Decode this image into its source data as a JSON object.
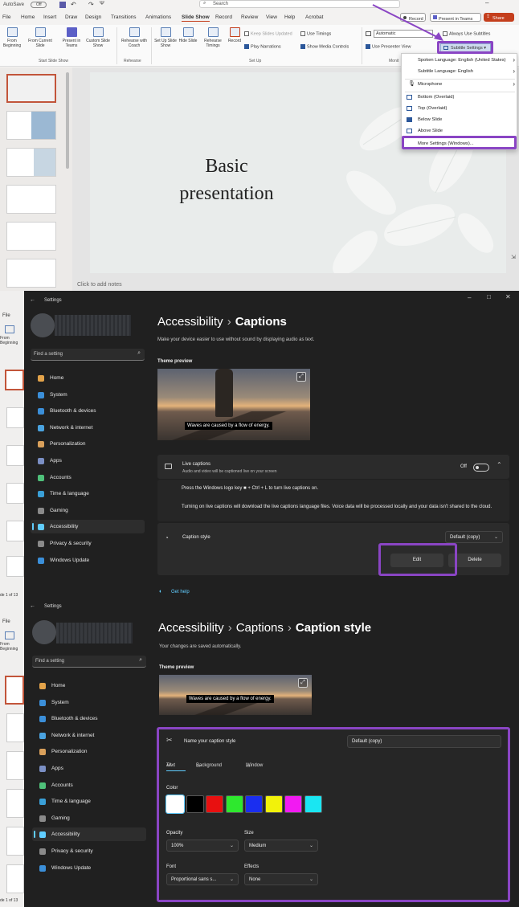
{
  "ppt": {
    "autosave": "AutoSave",
    "autosave_state": "Off",
    "search_placeholder": "Search",
    "menu": [
      "File",
      "Home",
      "Insert",
      "Draw",
      "Design",
      "Transitions",
      "Animations",
      "Slide Show",
      "Record",
      "Review",
      "View",
      "Help",
      "Acrobat"
    ],
    "active_menu": "Slide Show",
    "record_btn": "Record",
    "present_teams_btn": "Present in Teams",
    "share_btn": "Share",
    "ribbon": {
      "from_beginning": "From Beginning",
      "from_current": "From Current Slide",
      "present_teams": "Present in Teams",
      "custom_show": "Custom Slide Show",
      "group_start": "Start Slide Show",
      "rehearse_coach": "Rehearse with Coach",
      "group_rehearse": "Rehearse",
      "setup_show": "Set Up Slide Show",
      "hide_slide": "Hide Slide",
      "rehearse_timings": "Rehearse Timings",
      "record": "Record",
      "keep_updated": "Keep Slides Updated",
      "use_timings": "Use Timings",
      "play_narrations": "Play Narrations",
      "show_media": "Show Media Controls",
      "group_setup": "Set Up",
      "monitor_value": "Automatic",
      "presenter_view": "Use Presenter View",
      "always_subtitles": "Always Use Subtitles",
      "subtitle_settings": "Subtitle Settings",
      "group_monitors": "Monit"
    },
    "slide_title_line1": "Basic",
    "slide_title_line2": "presentation",
    "notes": "Click to add notes",
    "subtitle_menu": [
      {
        "label": "Spoken Language: English (United States)",
        "arrow": true
      },
      {
        "label": "Subtitle Language: English",
        "arrow": true
      },
      {
        "label": "Microphone",
        "arrow": true
      },
      {
        "label": "Bottom (Overlaid)",
        "arrow": false
      },
      {
        "label": "Top (Overlaid)",
        "arrow": false
      },
      {
        "label": "Below Slide",
        "arrow": false
      },
      {
        "label": "Above Slide",
        "arrow": false
      },
      {
        "label": "More Settings (Windows)...",
        "arrow": false
      }
    ],
    "bg_file": "File",
    "bg_from_beginning": "From Beginning",
    "bg_slide_count": "de 1 of 13"
  },
  "settings1": {
    "title": "Settings",
    "search_placeholder": "Find a setting",
    "nav": [
      "Home",
      "System",
      "Bluetooth & devices",
      "Network & internet",
      "Personalization",
      "Apps",
      "Accounts",
      "Time & language",
      "Gaming",
      "Accessibility",
      "Privacy & security",
      "Windows Update"
    ],
    "nav_colors": [
      "#e3a34a",
      "#3b8fd9",
      "#3b8fd9",
      "#4aa3e0",
      "#d9a05b",
      "#7b8fc4",
      "#4fc17a",
      "#3aa0d8",
      "#8a8a8a",
      "#60cdff",
      "#8a8a8a",
      "#3b8fd9"
    ],
    "breadcrumb1": "Accessibility",
    "breadcrumb2": "Captions",
    "description": "Make your device easier to use without sound by displaying audio as text.",
    "theme_preview": "Theme preview",
    "preview_caption": "Waves are caused by a flow of energy.",
    "live_captions_title": "Live captions",
    "live_captions_sub": "Audio and video will be captioned live on your screen",
    "toggle_state": "Off",
    "shortcut_text": "Press the Windows logo key ■ + Ctrl + L to turn live captions on.",
    "download_text": "Turning on live captions will download the live captions language files. Voice data will be processed locally and your data isn't shared to the cloud.",
    "caption_style": "Caption style",
    "caption_style_value": "Default (copy)",
    "edit_btn": "Edit",
    "delete_btn": "Delete",
    "get_help": "Get help"
  },
  "settings2": {
    "title": "Settings",
    "search_placeholder": "Find a setting",
    "breadcrumb1": "Accessibility",
    "breadcrumb2": "Captions",
    "breadcrumb3": "Caption style",
    "saved_text": "Your changes are saved automatically.",
    "theme_preview": "Theme preview",
    "preview_caption": "Waves are caused by a flow of energy.",
    "name_label": "Name your caption style",
    "name_value": "Default (copy)",
    "tabs": [
      "Text",
      "Background",
      "Window"
    ],
    "color_label": "Color",
    "colors": [
      "#ffffff",
      "#000000",
      "#e81010",
      "#2ee82e",
      "#1a2ef0",
      "#f2f20a",
      "#f21af2",
      "#1ae6f2"
    ],
    "opacity_label": "Opacity",
    "opacity_value": "100%",
    "size_label": "Size",
    "size_value": "Medium",
    "font_label": "Font",
    "font_value": "Proportional sans s...",
    "effects_label": "Effects",
    "effects_value": "None"
  }
}
